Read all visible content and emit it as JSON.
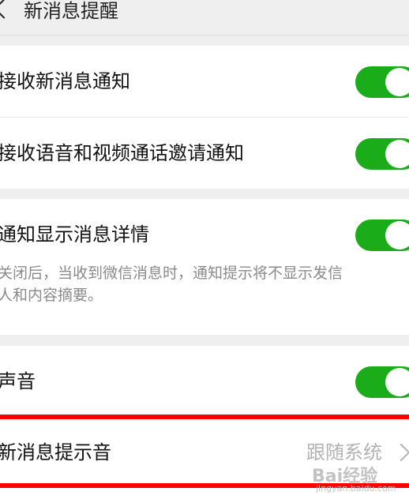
{
  "header": {
    "title": "新消息提醒"
  },
  "groups": {
    "notifications": {
      "receive_new_messages": {
        "label": "接收新消息通知",
        "enabled": true
      },
      "receive_call_invites": {
        "label": "接收语音和视频通话邀请通知",
        "enabled": true
      }
    },
    "details": {
      "show_details": {
        "label": "通知显示消息详情",
        "enabled": true
      },
      "description_line1": "关闭后，当收到微信消息时，通知提示将不显示发信",
      "description_line2": "人和内容摘要。"
    },
    "sound": {
      "sound": {
        "label": "声音",
        "enabled": true
      },
      "ringtone": {
        "label": "新消息提示音",
        "value": "跟随系统"
      }
    }
  },
  "watermark": {
    "brand": "Bai经验",
    "url": "jingyan.baidu.com"
  },
  "colors": {
    "toggle_on": "#1aad19",
    "highlight": "#ff0000",
    "background": "#efefef"
  }
}
